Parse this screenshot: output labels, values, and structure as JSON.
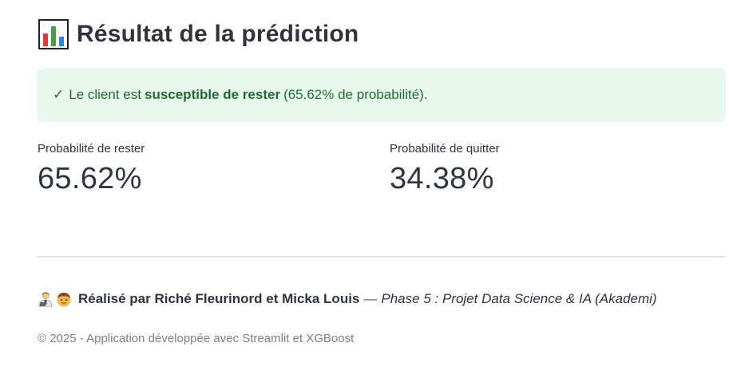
{
  "header": {
    "icon": "bar-chart-icon",
    "title": "Résultat de la prédiction"
  },
  "alert": {
    "icon": "check-icon",
    "check": "✓",
    "text_before": "Le client est",
    "text_strong": "susceptible de rester",
    "text_after": "(65.62% de probabilité).",
    "color": "#e8f8ec"
  },
  "metrics": [
    {
      "label": "Probabilité de rester",
      "value": "65.62%"
    },
    {
      "label": "Probabilité de quitter",
      "value": "34.38%"
    }
  ],
  "footer": {
    "avatar_icons": [
      "man-technologist-icon",
      "boy-icon"
    ],
    "authors": "Réalisé par Riché Fleurinord et Micka Louis",
    "dash": "—",
    "phase": "Phase 5 : Projet Data Science & IA (Akademi)",
    "copyright": "© 2025 - Application développée avec Streamlit et XGBoost"
  }
}
